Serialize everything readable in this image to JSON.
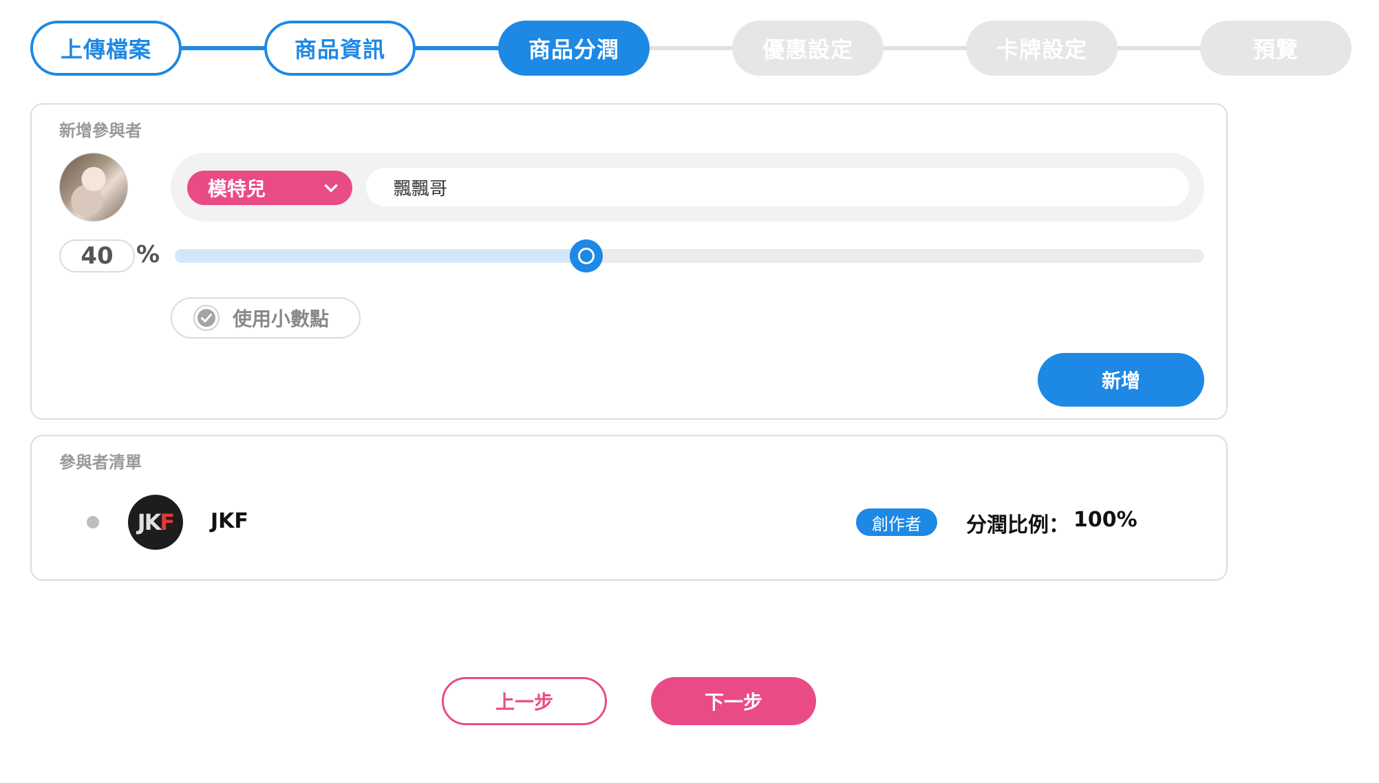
{
  "stepper": {
    "steps": [
      {
        "label": "上傳檔案",
        "state": "done"
      },
      {
        "label": "商品資訊",
        "state": "done"
      },
      {
        "label": "商品分潤",
        "state": "current"
      },
      {
        "label": "優惠設定",
        "state": "todo"
      },
      {
        "label": "卡牌設定",
        "state": "todo"
      },
      {
        "label": "預覽",
        "state": "todo"
      }
    ]
  },
  "add_participant": {
    "title": "新增參與者",
    "role_select": {
      "selected": "模特兒",
      "icon": "chevron-down-icon"
    },
    "name_input": {
      "value": "飄飄哥"
    },
    "percentage": {
      "value": "40",
      "unit": "%",
      "slider_fraction": 0.4
    },
    "decimal_toggle": {
      "label": "使用小數點",
      "icon": "check-circle-icon"
    },
    "add_button": "新增"
  },
  "participant_list": {
    "title": "參與者清單",
    "items": [
      {
        "logo_text": [
          "J",
          "K",
          "F"
        ],
        "name": "JKF",
        "role": "創作者",
        "share_label": "分潤比例：",
        "share_value": "100%"
      }
    ]
  },
  "navigation": {
    "prev": "上一步",
    "next": "下一步"
  },
  "colors": {
    "primary_blue": "#1e88e5",
    "accent_pink": "#e94b87",
    "inactive_gray": "#e6e6e6"
  }
}
